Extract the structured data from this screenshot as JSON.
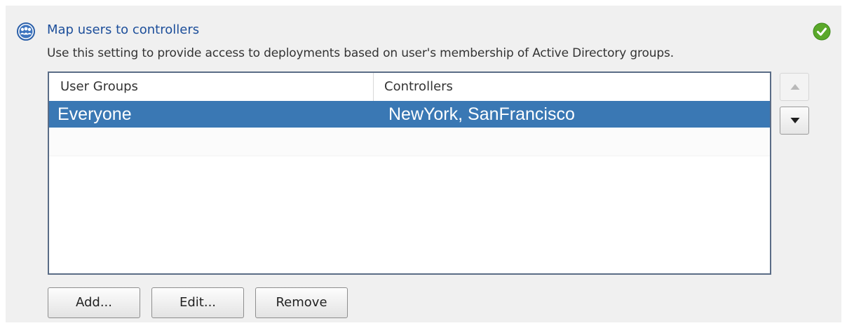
{
  "section": {
    "icon": "user-group-icon",
    "title": "Map users to controllers",
    "description": "Use this setting to provide access to deployments based on user's membership of Active Directory groups.",
    "status_icon": "checkmark-icon",
    "status_color": "#5aa82a"
  },
  "table": {
    "columns": [
      "User Groups",
      "Controllers"
    ],
    "rows": [
      {
        "user_group": "Everyone",
        "controllers": "NewYork, SanFrancisco",
        "selected": true
      }
    ],
    "selection_color": "#3a78b4"
  },
  "reorder": {
    "up_icon": "triangle-up-icon",
    "down_icon": "triangle-down-icon"
  },
  "buttons": {
    "add": "Add...",
    "edit": "Edit...",
    "remove": "Remove"
  }
}
